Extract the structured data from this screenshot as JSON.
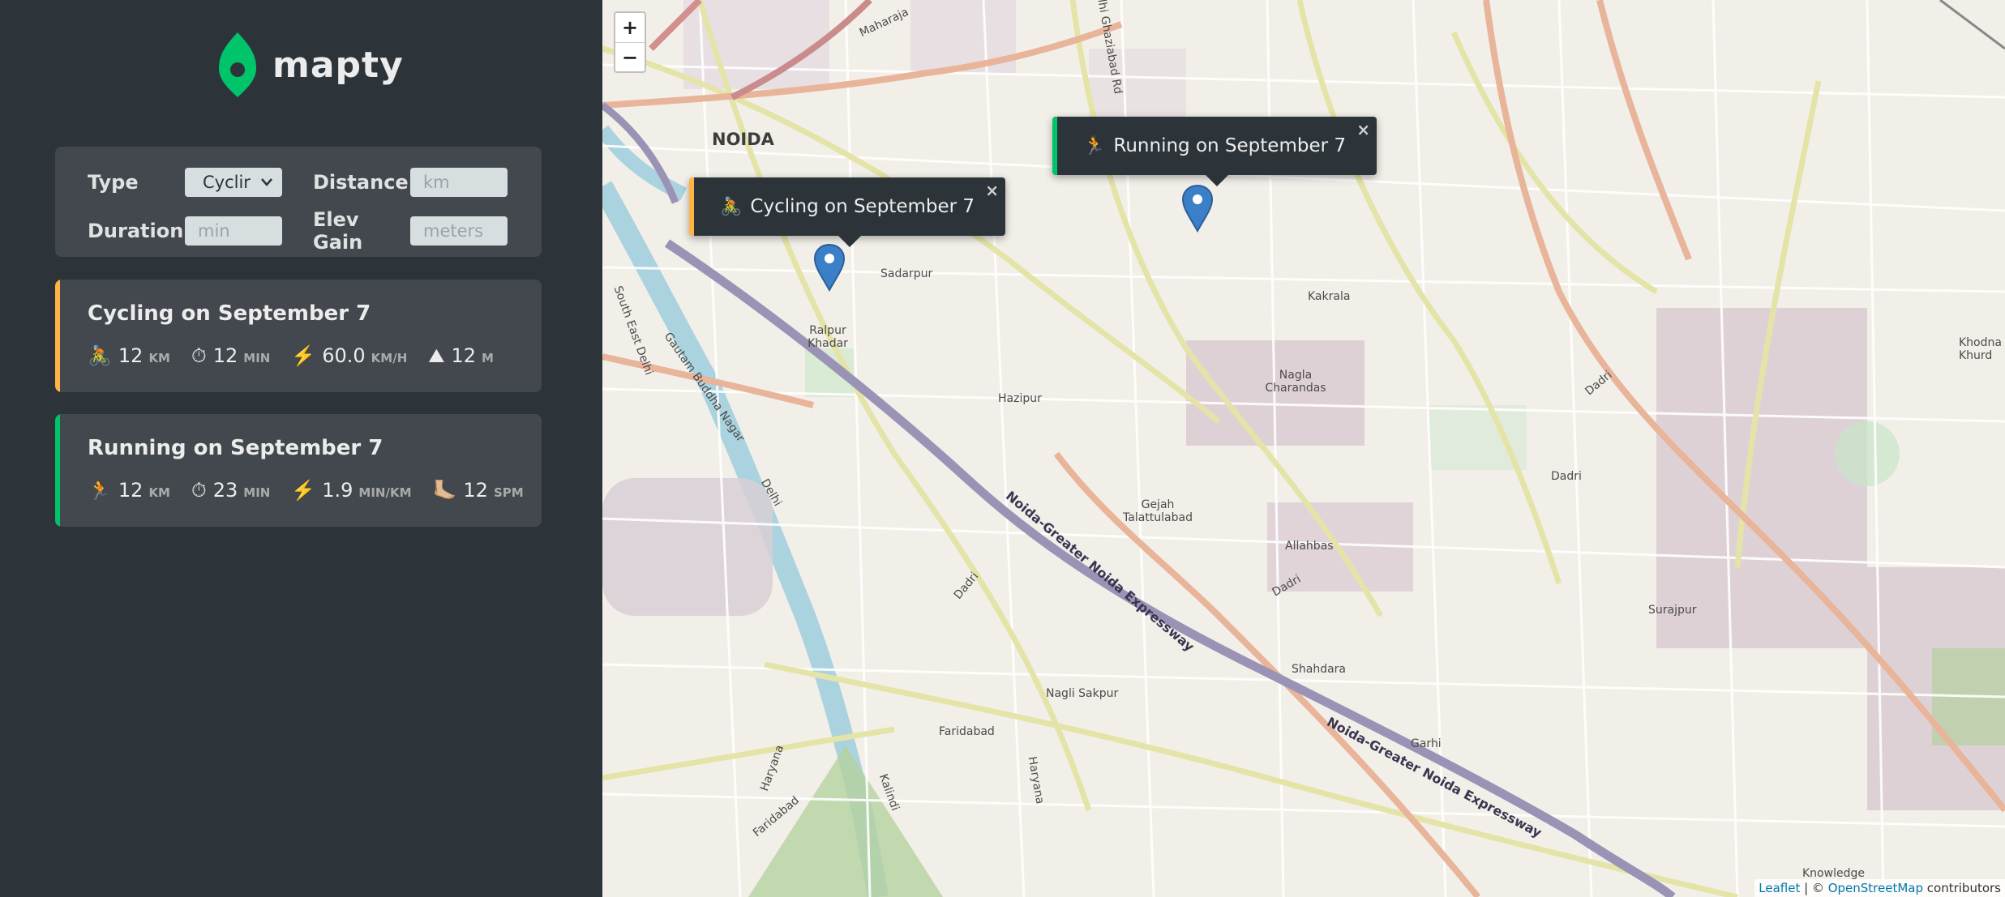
{
  "app": {
    "title": "mapty"
  },
  "form": {
    "type_label": "Type",
    "type_value": "Cyclir",
    "distance_label": "Distance",
    "distance_placeholder": "km",
    "duration_label": "Duration",
    "duration_placeholder": "min",
    "elev_label": "Elev Gain",
    "elev_placeholder": "meters"
  },
  "workouts": [
    {
      "title": "Cycling on September 7",
      "accent": "#ffb545",
      "stats": [
        {
          "icon": "🚴",
          "value": "12",
          "unit": "km"
        },
        {
          "icon": "⏱",
          "value": "12",
          "unit": "min"
        },
        {
          "icon": "⚡️",
          "value": "60.0",
          "unit": "km/h"
        },
        {
          "icon": "⛰",
          "value": "12",
          "unit": "m"
        }
      ]
    },
    {
      "title": "Running on September 7",
      "accent": "#00c46a",
      "stats": [
        {
          "icon": "🏃",
          "value": "12",
          "unit": "km"
        },
        {
          "icon": "⏱",
          "value": "23",
          "unit": "min"
        },
        {
          "icon": "⚡️",
          "value": "1.9",
          "unit": "min/km"
        },
        {
          "icon": "🦶🏼",
          "value": "12",
          "unit": "spm"
        }
      ]
    }
  ],
  "map": {
    "zoom_in": "+",
    "zoom_out": "−",
    "popups": [
      {
        "icon": "🚴",
        "text": "Cycling on September 7",
        "accent": "#ffb545"
      },
      {
        "icon": "🏃",
        "text": "Running on September 7",
        "accent": "#00c46a"
      }
    ],
    "close_symbol": "×",
    "labels": {
      "noida": "NOIDA",
      "sadarpur": "Sadarpur",
      "ralpur_khadar": "Ralpur Khadar",
      "hazipur": "Hazipur",
      "kakrala": "Kakrala",
      "nagla_charandas": "Nagla Charandas",
      "gejah": "Gejah Talattulabad",
      "allahbas": "Allahbas",
      "dadri1": "Dadri",
      "dadri2": "Dadri",
      "dadri3": "Dadri",
      "dadri4": "Dadri",
      "shahdara": "Shahdara",
      "nagli_sakpur": "Nagli Sakpur",
      "faridabad": "Faridabad",
      "haryana1": "Haryana",
      "haryana2": "Haryana",
      "garhi": "Garhi",
      "surajpur": "Surajpur",
      "khodna": "Khodna Khurd",
      "knowledge": "Knowledge",
      "expressway1": "Noida-Greater Noida Expressway",
      "expressway2": "Noida-Greater Noida Expressway",
      "south_east_delhi": "South East Delhi",
      "delhi": "Delhi",
      "gautam": "Gautam Buddha Nagar",
      "maharaja": "Maharaja",
      "ghaziabad": "Delhi Ghaziabad Rd",
      "faridabad2": "Faridabad",
      "ralpur_label_k": "Kalindi"
    },
    "attribution": {
      "leaflet": "Leaflet",
      "sep": " | © ",
      "osm": "OpenStreetMap",
      "contributors": " contributors"
    }
  }
}
